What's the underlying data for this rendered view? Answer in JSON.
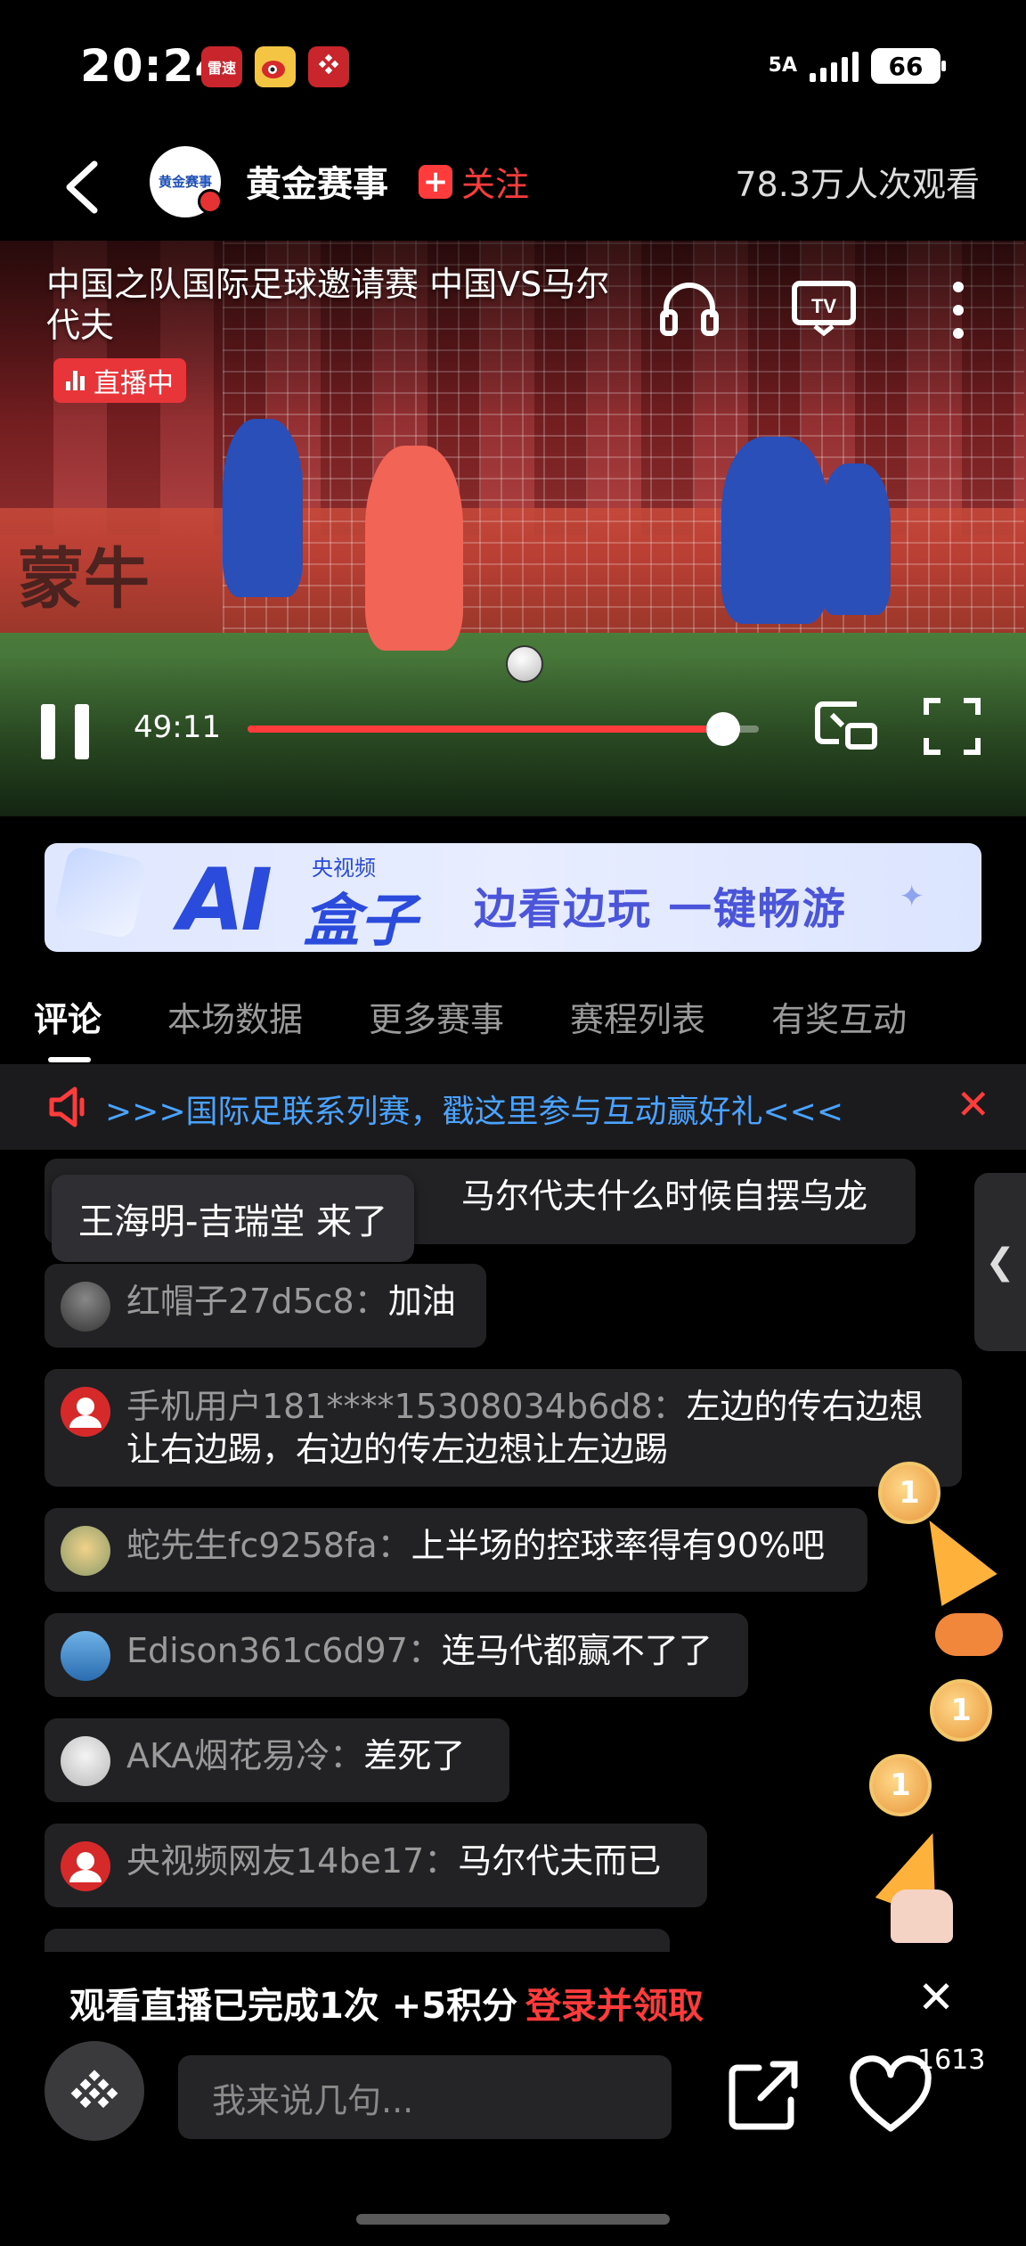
{
  "status_bar": {
    "time": "20:24",
    "network": "5A",
    "battery": "66",
    "apps": [
      {
        "icon": "leisu-app-icon",
        "label": "雷速",
        "color": "#c8252d"
      },
      {
        "icon": "weibo-app-icon",
        "label": "",
        "color": "#f4c542"
      },
      {
        "icon": "cctv-video-app-icon",
        "label": "",
        "color": "#c8252d"
      }
    ]
  },
  "header": {
    "channel_name": "黄金赛事",
    "channel_logo_text": "黄金赛事",
    "follow_label": "关注",
    "viewers": "78.3万人次观看"
  },
  "video": {
    "title": "中国之队国际足球邀请赛 中国VS马尔代夫",
    "live_label": "直播中",
    "board_text": "蒙牛",
    "time": "49:11",
    "progress": 0.93,
    "accent": "#ff3b3b"
  },
  "banner": {
    "brand": "央视频",
    "ai": "AI",
    "box": "盒子",
    "slogan": "边看边玩 一键畅游"
  },
  "tabs": [
    {
      "label": "评论",
      "active": true
    },
    {
      "label": "本场数据",
      "active": false
    },
    {
      "label": "更多赛事",
      "active": false
    },
    {
      "label": "赛程列表",
      "active": false
    },
    {
      "label": "有奖互动",
      "active": false
    }
  ],
  "notice": {
    "text": ">>>国际足联系列赛，戳这里参与互动赢好礼<<<"
  },
  "comments": {
    "enter_toast": "王海明-吉瑞堂 来了",
    "items": [
      {
        "user": "",
        "text": "马尔代夫什么时候自摆乌龙"
      },
      {
        "user": "红帽子27d5c8：",
        "text": "加油"
      },
      {
        "user": "手机用户181****15308034b6d8：",
        "text": "左边的传右边想让右边踢，右边的传左边想让左边踢"
      },
      {
        "user": "蛇先生fc9258fa：",
        "text": "上半场的控球率得有90%吧"
      },
      {
        "user": "Edison361c6d97：",
        "text": "连马代都赢不了了"
      },
      {
        "user": "AKA烟花易冷：",
        "text": "差死了"
      },
      {
        "user": "央视频网友14be17：",
        "text": "马尔代夫而已"
      }
    ],
    "medal_label": "1"
  },
  "reward": {
    "text": "观看直播已完成1次 +5积分",
    "link": "登录并领取"
  },
  "bottom_bar": {
    "input_placeholder": "我来说几句...",
    "like_count": "1613"
  }
}
